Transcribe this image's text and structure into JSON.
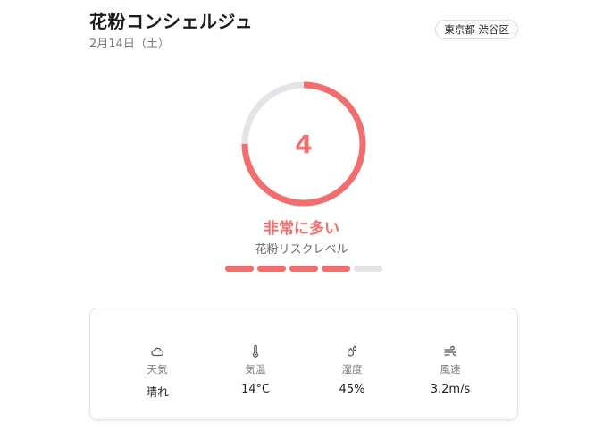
{
  "header": {
    "title": "花粉コンシェルジュ",
    "date": "2月14日（土）",
    "location": "東京都 渋谷区"
  },
  "risk": {
    "level": "4",
    "level_value": 4,
    "level_max": 5,
    "gauge_fraction": 0.75,
    "label": "非常に多い",
    "subtitle": "花粉リスクレベル",
    "accent_color": "#f26d6d",
    "track_color": "#e4e4e8"
  },
  "weather": {
    "items": [
      {
        "icon": "cloud-icon",
        "label": "天気",
        "value": "晴れ"
      },
      {
        "icon": "thermometer-icon",
        "label": "気温",
        "value": "14°C"
      },
      {
        "icon": "humidity-icon",
        "label": "湿度",
        "value": "45%"
      },
      {
        "icon": "wind-icon",
        "label": "風速",
        "value": "3.2m/s"
      }
    ]
  }
}
